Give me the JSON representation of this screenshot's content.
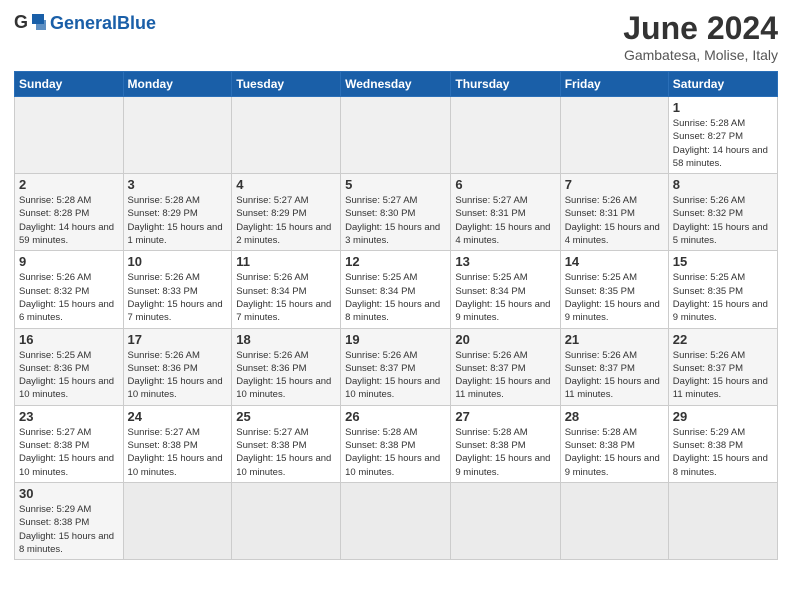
{
  "header": {
    "logo_general": "General",
    "logo_blue": "Blue",
    "month_title": "June 2024",
    "subtitle": "Gambatesa, Molise, Italy"
  },
  "weekdays": [
    "Sunday",
    "Monday",
    "Tuesday",
    "Wednesday",
    "Thursday",
    "Friday",
    "Saturday"
  ],
  "weeks": [
    [
      {
        "day": "",
        "info": ""
      },
      {
        "day": "",
        "info": ""
      },
      {
        "day": "",
        "info": ""
      },
      {
        "day": "",
        "info": ""
      },
      {
        "day": "",
        "info": ""
      },
      {
        "day": "",
        "info": ""
      },
      {
        "day": "1",
        "info": "Sunrise: 5:28 AM\nSunset: 8:27 PM\nDaylight: 14 hours\nand 58 minutes."
      }
    ],
    [
      {
        "day": "2",
        "info": "Sunrise: 5:28 AM\nSunset: 8:28 PM\nDaylight: 14 hours\nand 59 minutes."
      },
      {
        "day": "3",
        "info": "Sunrise: 5:28 AM\nSunset: 8:29 PM\nDaylight: 15 hours\nand 1 minute."
      },
      {
        "day": "4",
        "info": "Sunrise: 5:27 AM\nSunset: 8:29 PM\nDaylight: 15 hours\nand 2 minutes."
      },
      {
        "day": "5",
        "info": "Sunrise: 5:27 AM\nSunset: 8:30 PM\nDaylight: 15 hours\nand 3 minutes."
      },
      {
        "day": "6",
        "info": "Sunrise: 5:27 AM\nSunset: 8:31 PM\nDaylight: 15 hours\nand 4 minutes."
      },
      {
        "day": "7",
        "info": "Sunrise: 5:26 AM\nSunset: 8:31 PM\nDaylight: 15 hours\nand 4 minutes."
      },
      {
        "day": "8",
        "info": "Sunrise: 5:26 AM\nSunset: 8:32 PM\nDaylight: 15 hours\nand 5 minutes."
      }
    ],
    [
      {
        "day": "9",
        "info": "Sunrise: 5:26 AM\nSunset: 8:32 PM\nDaylight: 15 hours\nand 6 minutes."
      },
      {
        "day": "10",
        "info": "Sunrise: 5:26 AM\nSunset: 8:33 PM\nDaylight: 15 hours\nand 7 minutes."
      },
      {
        "day": "11",
        "info": "Sunrise: 5:26 AM\nSunset: 8:34 PM\nDaylight: 15 hours\nand 7 minutes."
      },
      {
        "day": "12",
        "info": "Sunrise: 5:25 AM\nSunset: 8:34 PM\nDaylight: 15 hours\nand 8 minutes."
      },
      {
        "day": "13",
        "info": "Sunrise: 5:25 AM\nSunset: 8:34 PM\nDaylight: 15 hours\nand 9 minutes."
      },
      {
        "day": "14",
        "info": "Sunrise: 5:25 AM\nSunset: 8:35 PM\nDaylight: 15 hours\nand 9 minutes."
      },
      {
        "day": "15",
        "info": "Sunrise: 5:25 AM\nSunset: 8:35 PM\nDaylight: 15 hours\nand 9 minutes."
      }
    ],
    [
      {
        "day": "16",
        "info": "Sunrise: 5:25 AM\nSunset: 8:36 PM\nDaylight: 15 hours\nand 10 minutes."
      },
      {
        "day": "17",
        "info": "Sunrise: 5:26 AM\nSunset: 8:36 PM\nDaylight: 15 hours\nand 10 minutes."
      },
      {
        "day": "18",
        "info": "Sunrise: 5:26 AM\nSunset: 8:36 PM\nDaylight: 15 hours\nand 10 minutes."
      },
      {
        "day": "19",
        "info": "Sunrise: 5:26 AM\nSunset: 8:37 PM\nDaylight: 15 hours\nand 10 minutes."
      },
      {
        "day": "20",
        "info": "Sunrise: 5:26 AM\nSunset: 8:37 PM\nDaylight: 15 hours\nand 11 minutes."
      },
      {
        "day": "21",
        "info": "Sunrise: 5:26 AM\nSunset: 8:37 PM\nDaylight: 15 hours\nand 11 minutes."
      },
      {
        "day": "22",
        "info": "Sunrise: 5:26 AM\nSunset: 8:37 PM\nDaylight: 15 hours\nand 11 minutes."
      }
    ],
    [
      {
        "day": "23",
        "info": "Sunrise: 5:27 AM\nSunset: 8:38 PM\nDaylight: 15 hours\nand 10 minutes."
      },
      {
        "day": "24",
        "info": "Sunrise: 5:27 AM\nSunset: 8:38 PM\nDaylight: 15 hours\nand 10 minutes."
      },
      {
        "day": "25",
        "info": "Sunrise: 5:27 AM\nSunset: 8:38 PM\nDaylight: 15 hours\nand 10 minutes."
      },
      {
        "day": "26",
        "info": "Sunrise: 5:28 AM\nSunset: 8:38 PM\nDaylight: 15 hours\nand 10 minutes."
      },
      {
        "day": "27",
        "info": "Sunrise: 5:28 AM\nSunset: 8:38 PM\nDaylight: 15 hours\nand 9 minutes."
      },
      {
        "day": "28",
        "info": "Sunrise: 5:28 AM\nSunset: 8:38 PM\nDaylight: 15 hours\nand 9 minutes."
      },
      {
        "day": "29",
        "info": "Sunrise: 5:29 AM\nSunset: 8:38 PM\nDaylight: 15 hours\nand 8 minutes."
      }
    ],
    [
      {
        "day": "30",
        "info": "Sunrise: 5:29 AM\nSunset: 8:38 PM\nDaylight: 15 hours\nand 8 minutes."
      },
      {
        "day": "",
        "info": ""
      },
      {
        "day": "",
        "info": ""
      },
      {
        "day": "",
        "info": ""
      },
      {
        "day": "",
        "info": ""
      },
      {
        "day": "",
        "info": ""
      },
      {
        "day": "",
        "info": ""
      }
    ]
  ]
}
